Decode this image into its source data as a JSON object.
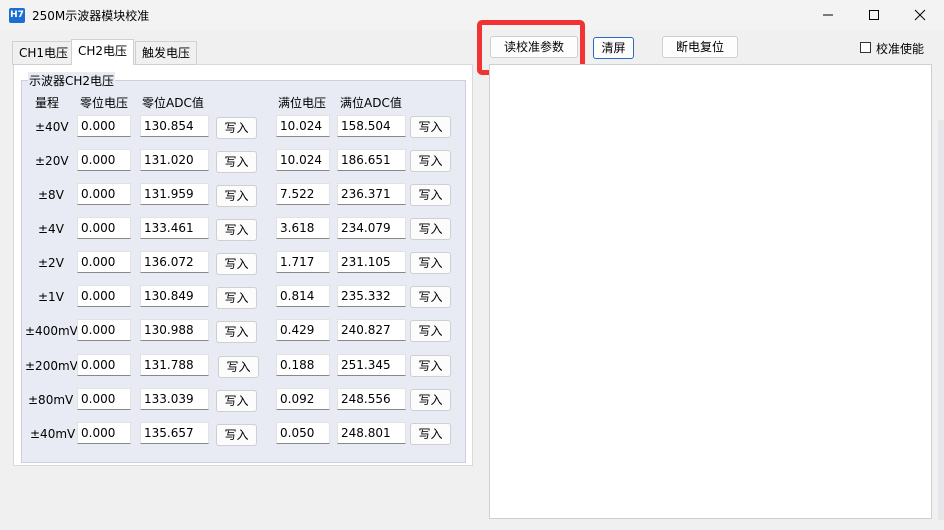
{
  "window": {
    "icon_text": "H7",
    "title": "250M示波器模块校准"
  },
  "tabs": [
    {
      "label": "CH1电压",
      "active": false
    },
    {
      "label": "CH2电压",
      "active": true
    },
    {
      "label": "触发电压",
      "active": false
    }
  ],
  "group": {
    "title": "示波器CH2电压"
  },
  "headers": {
    "range": "量程",
    "zero_voltage": "零位电压",
    "zero_adc": "零位ADC值",
    "full_voltage": "满位电压",
    "full_adc": "满位ADC值"
  },
  "write_label": "写入",
  "rows": [
    {
      "range": "±40V",
      "zero_v": "0.000",
      "zero_adc": "130.854",
      "full_v": "10.024",
      "full_adc": "158.504"
    },
    {
      "range": "±20V",
      "zero_v": "0.000",
      "zero_adc": "131.020",
      "full_v": "10.024",
      "full_adc": "186.651"
    },
    {
      "range": "±8V",
      "zero_v": "0.000",
      "zero_adc": "131.959",
      "full_v": "7.522",
      "full_adc": "236.371"
    },
    {
      "range": "±4V",
      "zero_v": "0.000",
      "zero_adc": "133.461",
      "full_v": "3.618",
      "full_adc": "234.079"
    },
    {
      "range": "±2V",
      "zero_v": "0.000",
      "zero_adc": "136.072",
      "full_v": "1.717",
      "full_adc": "231.105"
    },
    {
      "range": "±1V",
      "zero_v": "0.000",
      "zero_adc": "130.849",
      "full_v": "0.814",
      "full_adc": "235.332"
    },
    {
      "range": "±400mV",
      "zero_v": "0.000",
      "zero_adc": "130.988",
      "full_v": "0.429",
      "full_adc": "240.827"
    },
    {
      "range": "±200mV",
      "zero_v": "0.000",
      "zero_adc": "131.788",
      "full_v": "0.188",
      "full_adc": "251.345"
    },
    {
      "range": "±80mV",
      "zero_v": "0.000",
      "zero_adc": "133.039",
      "full_v": "0.092",
      "full_adc": "248.556"
    },
    {
      "range": "±40mV",
      "zero_v": "0.000",
      "zero_adc": "135.657",
      "full_v": "0.050",
      "full_adc": "248.801"
    }
  ],
  "toolbar": {
    "read_params": "读校准参数",
    "clear": "清屏",
    "power_reset": "断电复位",
    "calib_enable": "校准使能",
    "calib_enable_checked": false
  },
  "colors": {
    "highlight": "#f23333",
    "group_bg": "#e8eaf4",
    "icon_bg": "#1c6fd0"
  }
}
